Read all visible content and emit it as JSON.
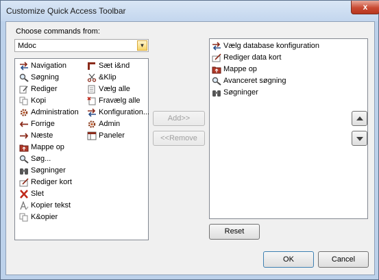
{
  "window": {
    "title": "Customize Quick Access Toolbar",
    "close_glyph": "x"
  },
  "choose": {
    "label": "Choose commands from:",
    "value": "Mdoc"
  },
  "left_col1": [
    {
      "label": "Navigation",
      "icon": "swap-arrows-icon"
    },
    {
      "label": "Søgning",
      "icon": "magnifier-icon"
    },
    {
      "label": "Rediger",
      "icon": "edit-icon"
    },
    {
      "label": "Kopi",
      "icon": "copy-icon"
    },
    {
      "label": "Administration",
      "icon": "gear-icon"
    },
    {
      "label": "Forrige",
      "icon": "arrow-left-icon"
    },
    {
      "label": "Næste",
      "icon": "arrow-right-icon"
    },
    {
      "label": "Mappe op",
      "icon": "folder-up-icon"
    },
    {
      "label": "Søg...",
      "icon": "magnifier-icon"
    },
    {
      "label": "Søgninger",
      "icon": "binoculars-icon"
    },
    {
      "label": "Rediger kort",
      "icon": "edit-card-icon"
    },
    {
      "label": "Slet",
      "icon": "delete-x-icon"
    },
    {
      "label": "Kopier tekst",
      "icon": "copy-text-icon"
    },
    {
      "label": "K&opier",
      "icon": "copy-icon"
    }
  ],
  "left_col2": [
    {
      "label": "Sæt i&nd",
      "icon": "paste-icon"
    },
    {
      "label": "&Klip",
      "icon": "scissors-icon"
    },
    {
      "label": "Vælg alle",
      "icon": "select-all-icon"
    },
    {
      "label": "Fravælg alle",
      "icon": "deselect-all-icon"
    },
    {
      "label": "Konfiguration...",
      "icon": "swap-arrows-icon"
    },
    {
      "label": "Admin",
      "icon": "gear-icon"
    },
    {
      "label": "Paneler",
      "icon": "panels-icon"
    }
  ],
  "right_items": [
    {
      "label": "Vælg database konfiguration",
      "icon": "swap-arrows-icon"
    },
    {
      "label": "Rediger data kort",
      "icon": "edit-card-icon"
    },
    {
      "label": "Mappe op",
      "icon": "folder-up-icon"
    },
    {
      "label": "Avanceret søgning",
      "icon": "magnifier-icon"
    },
    {
      "label": "Søgninger",
      "icon": "binoculars-icon"
    }
  ],
  "buttons": {
    "add": "Add>>",
    "remove": "<<Remove",
    "reset": "Reset",
    "ok": "OK",
    "cancel": "Cancel"
  },
  "colors": {
    "accent": "#c0392b",
    "window_frame": "#bcd1ea",
    "dialog_bg": "#f0f0f0"
  }
}
